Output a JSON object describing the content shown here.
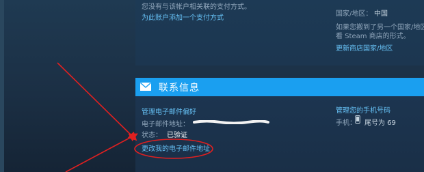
{
  "payment": {
    "no_methods_text": "您没有与该帐户相关联的支付方式。",
    "add_method_link": "为此账户添加一个支付方式"
  },
  "region": {
    "label": "国家/地区：",
    "value": "中国",
    "moved_line1": "如果您搬到了另一个国家/地区",
    "moved_line2": "看 Steam 商店的形式。",
    "update_link": "更新商店国家/地区"
  },
  "contact": {
    "title": "联系信息",
    "manage_email_link": "管理电子邮件偏好",
    "email_label": "电子邮件地址：",
    "status_label": "状态：",
    "status_value": "已验证",
    "change_email_link": "更改我的电子邮件地址",
    "manage_phone_link": "管理您的手机号码",
    "phone_label": "手机：",
    "phone_value": "尾号为 69"
  },
  "colors": {
    "accent": "#1a9ff0",
    "link": "#66c0f4",
    "annotation": "#e02020"
  },
  "icons": {
    "mail": "envelope-icon",
    "phone": "mobile-phone-icon"
  }
}
